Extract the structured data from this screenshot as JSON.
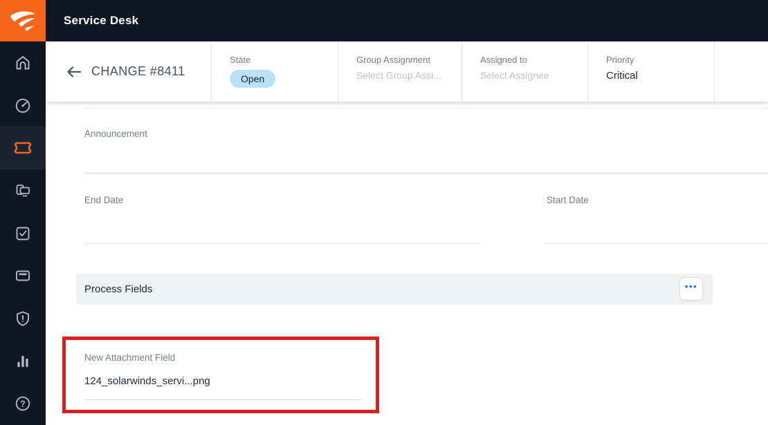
{
  "topbar": {
    "app_title": "Service Desk"
  },
  "sidebar": {
    "active_item": "tickets",
    "items": [
      {
        "icon": "home-icon"
      },
      {
        "icon": "dashboard-gauge-icon"
      },
      {
        "icon": "ticket-icon"
      },
      {
        "icon": "devices-icon"
      },
      {
        "icon": "tasks-checkbox-icon"
      },
      {
        "icon": "card-icon"
      },
      {
        "icon": "shield-alert-icon"
      },
      {
        "icon": "bar-chart-icon"
      },
      {
        "icon": "help-icon"
      }
    ]
  },
  "header": {
    "title": "CHANGE #8411",
    "state": {
      "label": "State",
      "value": "Open"
    },
    "group_assignment": {
      "label": "Group Assignment",
      "placeholder": "Select Group Assi..."
    },
    "assigned_to": {
      "label": "Assigned to",
      "placeholder": "Select Assignee"
    },
    "priority": {
      "label": "Priority",
      "value": "Critical"
    }
  },
  "form": {
    "announcement": {
      "label": "Announcement",
      "value": ""
    },
    "end_date": {
      "label": "End Date",
      "value": ""
    },
    "start_date": {
      "label": "Start Date",
      "value": ""
    },
    "process_fields": {
      "title": "Process Fields",
      "menu_icon": "•••"
    },
    "new_attachment": {
      "label": "New Attachment Field",
      "value": "124_solarwinds_servi...png"
    }
  },
  "colors": {
    "topbar_bg": "#0e1724",
    "brand_orange": "#f4661c",
    "active_nav_bg": "#1b2532",
    "state_pill_bg": "#b9e1f8",
    "menu_dots_blue": "#2f6ae0",
    "annotation_red": "#d92121"
  }
}
